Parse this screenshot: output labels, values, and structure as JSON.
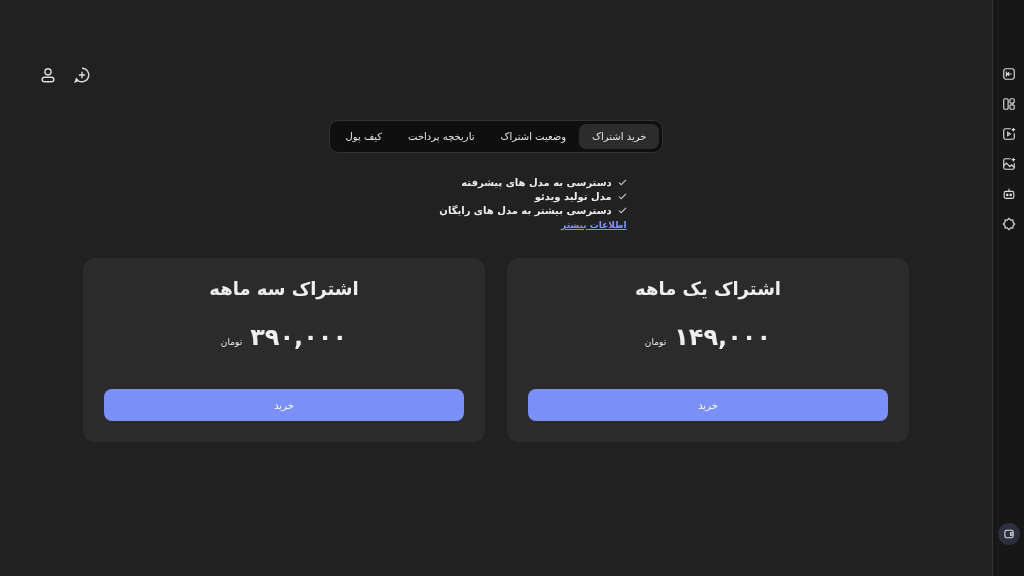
{
  "tabs": [
    {
      "label": "خرید اشتراک",
      "selected": true
    },
    {
      "label": "وضعیت اشتراک",
      "selected": false
    },
    {
      "label": "تاریخچه پرداخت",
      "selected": false
    },
    {
      "label": "کیف پول",
      "selected": false
    }
  ],
  "features": [
    "دسترسی به مدل های پیشرفته",
    "مدل تولید ویدئو",
    "دسترسی بیشتر به مدل های رایگان"
  ],
  "more_link": "اطلاعات بیشتر",
  "plans": [
    {
      "title": "اشتراک یک ماهه",
      "price": "۱۴۹,۰۰۰",
      "currency": "تومان",
      "button": "خرید"
    },
    {
      "title": "اشتراک سه ماهه",
      "price": "۳۹۰,۰۰۰",
      "currency": "تومان",
      "button": "خرید"
    }
  ]
}
